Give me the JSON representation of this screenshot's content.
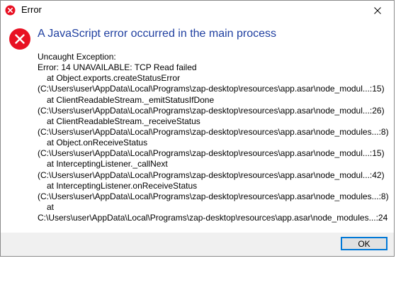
{
  "window": {
    "title": "Error",
    "title_icon": "error-icon",
    "close_icon": "close-icon"
  },
  "dialog": {
    "icon": "error-icon",
    "heading": "A JavaScript error occurred in the main process",
    "lines": [
      {
        "text": "Uncaught Exception:",
        "indent": false
      },
      {
        "text": "Error: 14 UNAVAILABLE: TCP Read failed",
        "indent": false
      },
      {
        "text": "at Object.exports.createStatusError",
        "indent": true
      },
      {
        "text": "(C:\\Users\\user\\AppData\\Local\\Programs\\zap-desktop\\resources\\app.asar\\node_modul...:15)",
        "indent": false
      },
      {
        "text": "at ClientReadableStream._emitStatusIfDone",
        "indent": true
      },
      {
        "text": "(C:\\Users\\user\\AppData\\Local\\Programs\\zap-desktop\\resources\\app.asar\\node_modul...:26)",
        "indent": false
      },
      {
        "text": "at ClientReadableStream._receiveStatus",
        "indent": true
      },
      {
        "text": "(C:\\Users\\user\\AppData\\Local\\Programs\\zap-desktop\\resources\\app.asar\\node_modules...:8)",
        "indent": false
      },
      {
        "text": "at Object.onReceiveStatus",
        "indent": true
      },
      {
        "text": "(C:\\Users\\user\\AppData\\Local\\Programs\\zap-desktop\\resources\\app.asar\\node_modul...:15)",
        "indent": false
      },
      {
        "text": "at InterceptingListener._callNext",
        "indent": true
      },
      {
        "text": "(C:\\Users\\user\\AppData\\Local\\Programs\\zap-desktop\\resources\\app.asar\\node_modul...:42)",
        "indent": false
      },
      {
        "text": "at InterceptingListener.onReceiveStatus",
        "indent": true
      },
      {
        "text": "(C:\\Users\\user\\AppData\\Local\\Programs\\zap-desktop\\resources\\app.asar\\node_modules...:8)",
        "indent": false
      },
      {
        "text": "at",
        "indent": true
      },
      {
        "text": "C:\\Users\\user\\AppData\\Local\\Programs\\zap-desktop\\resources\\app.asar\\node_modules...:24",
        "indent": false
      }
    ],
    "ok_label": "OK"
  },
  "colors": {
    "error_red": "#e81123",
    "heading_blue": "#1f3fa0",
    "button_border": "#0078d7",
    "footer_bg": "#f0f0f0"
  }
}
